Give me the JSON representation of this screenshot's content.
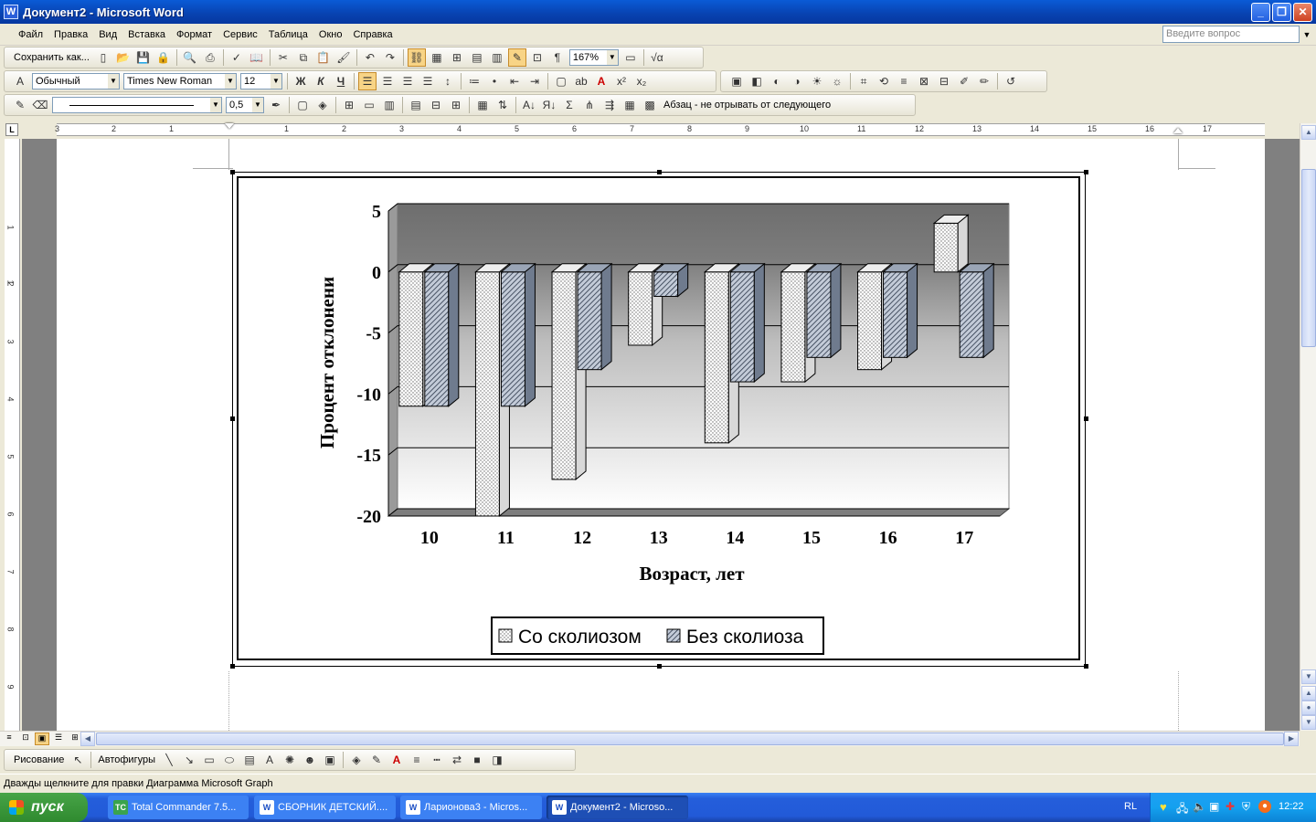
{
  "window": {
    "title": "Документ2 - Microsoft Word",
    "icon": "W"
  },
  "menu": {
    "items": [
      "Файл",
      "Правка",
      "Вид",
      "Вставка",
      "Формат",
      "Сервис",
      "Таблица",
      "Окно",
      "Справка"
    ],
    "ask_placeholder": "Введите вопрос"
  },
  "toolbar1": {
    "save_as": "Сохранить как...",
    "zoom": "167%"
  },
  "toolbar2": {
    "style": "Обычный",
    "font": "Times New Roman",
    "size": "12",
    "bold": "Ж",
    "italic": "К",
    "underline": "Ч"
  },
  "toolbar3": {
    "line_width": "0,5",
    "paragraph_option": "Абзац - не отрывать от следующего"
  },
  "ruler": {
    "numbers": [
      "3",
      "2",
      "1",
      "1",
      "2",
      "3",
      "4",
      "5",
      "6",
      "7",
      "8",
      "9",
      "10",
      "11",
      "12",
      "13",
      "14",
      "15",
      "16",
      "17"
    ],
    "vnumbers": [
      "1",
      "1",
      "2",
      "3",
      "4",
      "5",
      "6",
      "7",
      "8",
      "9"
    ]
  },
  "drawbar": {
    "drawing": "Рисование",
    "autoshapes": "Автофигуры"
  },
  "status": {
    "text": "Дважды щелкните для правки Диаграмма Microsoft Graph"
  },
  "taskbar": {
    "start": "пуск",
    "tasks": [
      {
        "label": "Total Commander 7.5..."
      },
      {
        "label": "СБОРНИК ДЕТСКИЙ...."
      },
      {
        "label": "Ларионова3 - Micros..."
      },
      {
        "label": "Документ2 - Microso..."
      }
    ],
    "lang": "RL",
    "clock": "12:22"
  },
  "chart_data": {
    "type": "bar",
    "categories": [
      "10",
      "11",
      "12",
      "13",
      "14",
      "15",
      "16",
      "17"
    ],
    "series": [
      {
        "name": "Со сколиозом",
        "values": [
          -11,
          -20,
          -17,
          -6,
          -14,
          -9,
          -8,
          4
        ]
      },
      {
        "name": "Без сколиоза",
        "values": [
          -11,
          -11,
          -8,
          -2,
          -9,
          -7,
          -7,
          -7
        ]
      }
    ],
    "xlabel": "Возраст, лет",
    "ylabel": "Процент отклонени",
    "yticks": [
      "5",
      "0",
      "-5",
      "-10",
      "-15",
      "-20"
    ],
    "ylim": [
      -20,
      5
    ],
    "grid": true,
    "legend": "bottom",
    "colors": {
      "back_wall_top": "#7a7a7a",
      "back_wall_bottom": "#ffffff",
      "bar_face": "#ffffff",
      "bar_face2": "#c8d0dc"
    }
  }
}
